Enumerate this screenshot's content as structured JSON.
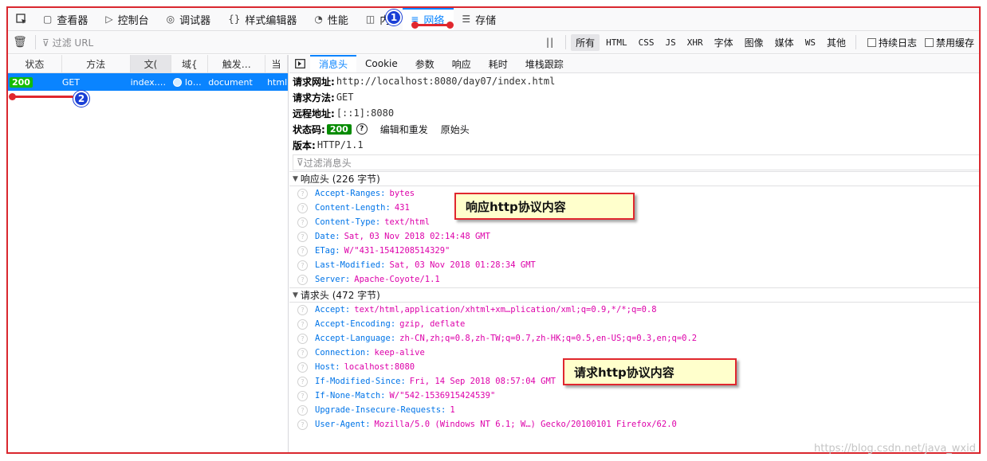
{
  "toolbox": {
    "tabs": [
      {
        "label": "查看器",
        "icon": "inspector-icon",
        "glyph": "▢"
      },
      {
        "label": "控制台",
        "icon": "console-icon",
        "glyph": "▷"
      },
      {
        "label": "调试器",
        "icon": "debugger-icon",
        "glyph": "◎"
      },
      {
        "label": "样式编辑器",
        "icon": "style-editor-icon",
        "glyph": "{}"
      },
      {
        "label": "性能",
        "icon": "performance-icon",
        "glyph": "◔"
      },
      {
        "label": "内",
        "icon": "memory-icon",
        "glyph": "◫"
      },
      {
        "label": "网络",
        "icon": "network-icon",
        "glyph": "≡"
      },
      {
        "label": "存储",
        "icon": "storage-icon",
        "glyph": "☰"
      }
    ],
    "active_tab": "网络"
  },
  "filterbar": {
    "url_placeholder": "过滤 URL",
    "pause_label": "||",
    "types": [
      "所有",
      "HTML",
      "CSS",
      "JS",
      "XHR",
      "字体",
      "图像",
      "媒体",
      "WS",
      "其他"
    ],
    "selected_type": "所有",
    "persist_logs": "持续日志",
    "disable_cache": "禁用缓存"
  },
  "request_list": {
    "columns": [
      "状态",
      "方法",
      "文件",
      "域名",
      "触发…",
      "类"
    ],
    "visible_columns": [
      "状态",
      "方法",
      "文(",
      "域{",
      "触发…",
      "当"
    ],
    "sorted_column": "文件",
    "row": {
      "status": "200",
      "method": "GET",
      "file": "index.…",
      "domain": "lo…",
      "cause": "document",
      "type": "html"
    }
  },
  "details": {
    "tabs": [
      "消息头",
      "Cookie",
      "参数",
      "响应",
      "耗时",
      "堆栈跟踪"
    ],
    "active_tab": "消息头",
    "summary": {
      "url_label": "请求网址:",
      "url": "http://localhost:8080/day07/index.html",
      "method_label": "请求方法:",
      "method": "GET",
      "remote_label": "远程地址:",
      "remote": "[::1]:8080",
      "status_label": "状态码:",
      "status": "200",
      "edit_resend": "编辑和重发",
      "raw_headers": "原始头",
      "version_label": "版本:",
      "version": "HTTP/1.1"
    },
    "header_filter_placeholder": "过滤消息头",
    "response_section": {
      "title": "响应头 (226 字节)",
      "headers": [
        {
          "name": "Accept-Ranges:",
          "value": "bytes"
        },
        {
          "name": "Content-Length:",
          "value": "431"
        },
        {
          "name": "Content-Type:",
          "value": "text/html"
        },
        {
          "name": "Date:",
          "value": "Sat, 03 Nov 2018 02:14:48 GMT"
        },
        {
          "name": "ETag:",
          "value": "W/\"431-1541208514329\""
        },
        {
          "name": "Last-Modified:",
          "value": "Sat, 03 Nov 2018 01:28:34 GMT"
        },
        {
          "name": "Server:",
          "value": "Apache-Coyote/1.1"
        }
      ]
    },
    "request_section": {
      "title": "请求头 (472 字节)",
      "headers": [
        {
          "name": "Accept:",
          "value": "text/html,application/xhtml+xm…plication/xml;q=0.9,*/*;q=0.8"
        },
        {
          "name": "Accept-Encoding:",
          "value": "gzip, deflate"
        },
        {
          "name": "Accept-Language:",
          "value": "zh-CN,zh;q=0.8,zh-TW;q=0.7,zh-HK;q=0.5,en-US;q=0.3,en;q=0.2"
        },
        {
          "name": "Connection:",
          "value": "keep-alive"
        },
        {
          "name": "Host:",
          "value": "localhost:8080"
        },
        {
          "name": "If-Modified-Since:",
          "value": "Fri, 14 Sep 2018 08:57:04 GMT"
        },
        {
          "name": "If-None-Match:",
          "value": "W/\"542-1536915424539\""
        },
        {
          "name": "Upgrade-Insecure-Requests:",
          "value": "1"
        },
        {
          "name": "User-Agent:",
          "value": "Mozilla/5.0 (Windows NT 6.1; W…) Gecko/20100101 Firefox/62.0"
        }
      ]
    }
  },
  "annotations": {
    "callout_response": "响应http协议内容",
    "callout_request": "请求http协议内容",
    "marker1": "1",
    "marker2": "2"
  },
  "watermark": "https://blog.csdn.net/java_wxid",
  "colors": {
    "accent": "#0a84ff",
    "status_ok": "#058b00",
    "annotation_red": "#e0272e",
    "header_name": "#0074e8",
    "header_value": "#dd00a9"
  }
}
